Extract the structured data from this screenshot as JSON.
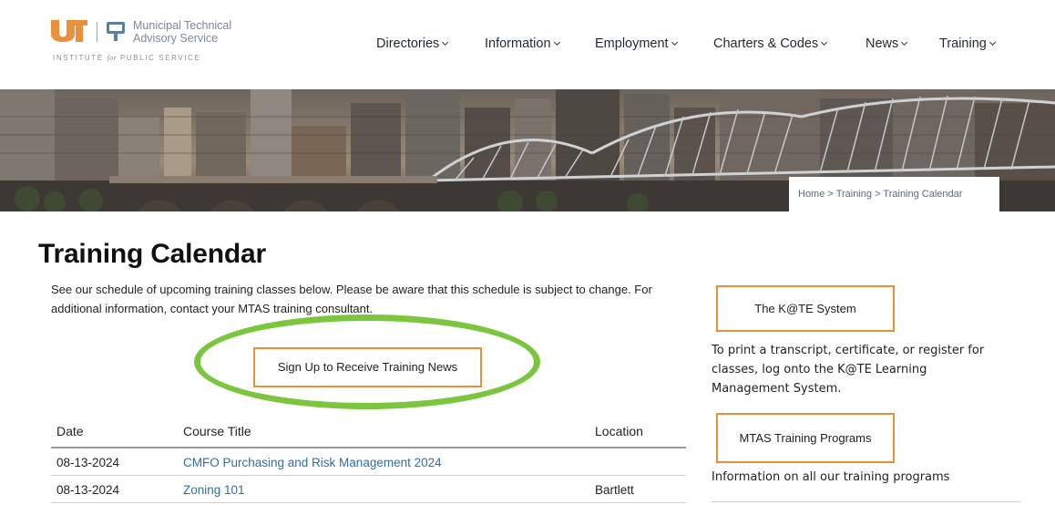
{
  "brand": {
    "org_name_line1": "Municipal Technical",
    "org_name_line2": "Advisory Service",
    "institute_pre": "INSTITUTE",
    "institute_for": "for",
    "institute_post": "PUBLIC SERVICE",
    "ut_color": "#e8913a",
    "seal_color": "#5a7fa6"
  },
  "nav": {
    "items": [
      {
        "label": "Directories"
      },
      {
        "label": "Information"
      },
      {
        "label": "Employment"
      },
      {
        "label": "Charters & Codes"
      },
      {
        "label": "News"
      },
      {
        "label": "Training"
      }
    ]
  },
  "breadcrumb": {
    "home": "Home",
    "sep": ">",
    "training": "Training",
    "current": "Training Calendar"
  },
  "page": {
    "title": "Training Calendar",
    "intro": "See our schedule of upcoming training classes below. Please be aware that this schedule is subject to change. For additional information, contact your MTAS training consultant.",
    "signup_label": "Sign Up to Receive Training News",
    "highlight_color": "#7cc53e",
    "button_border_color": "#e8913a",
    "link_color": "#2e6fa7"
  },
  "table": {
    "headers": {
      "date": "Date",
      "title": "Course Title",
      "location": "Location"
    },
    "rows": [
      {
        "date": "08-13-2024",
        "title": "CMFO Purchasing and Risk Management 2024",
        "location": ""
      },
      {
        "date": "08-13-2024",
        "title": "Zoning 101",
        "location": "Bartlett"
      }
    ]
  },
  "sidebar": {
    "kate_label": "The K@TE System",
    "kate_text": "To print a transcript, certificate, or register for classes, log onto the K@TE Learning Management System.",
    "programs_label": "MTAS Training Programs",
    "programs_text": "Information on all our training programs"
  }
}
